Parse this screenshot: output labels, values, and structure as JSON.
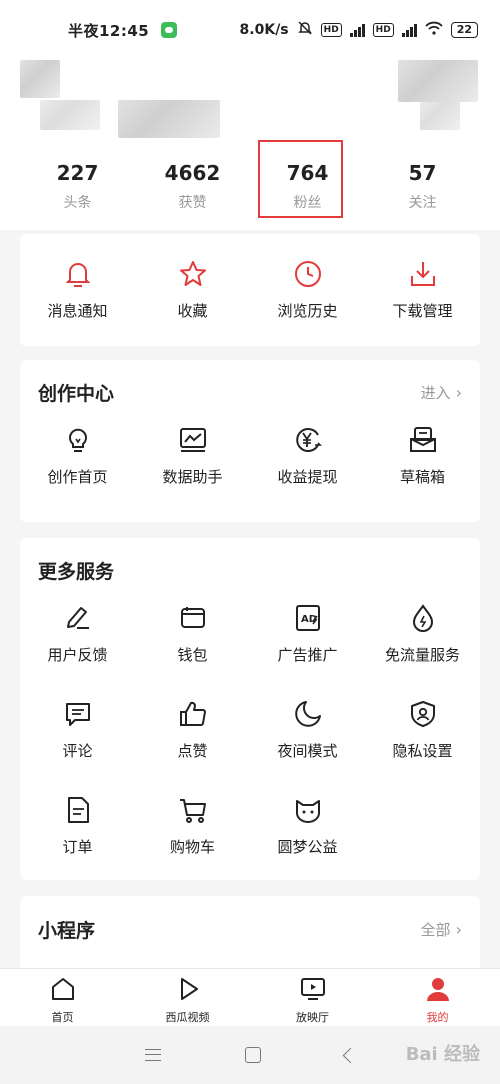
{
  "status_bar": {
    "time": "半夜12:45",
    "speed": "8.0K/s",
    "battery": "22"
  },
  "stats": [
    {
      "value": "227",
      "label": "头条"
    },
    {
      "value": "4662",
      "label": "获赞"
    },
    {
      "value": "764",
      "label": "粉丝"
    },
    {
      "value": "57",
      "label": "关注"
    }
  ],
  "quick_actions": [
    {
      "label": "消息通知",
      "icon": "bell-icon"
    },
    {
      "label": "收藏",
      "icon": "star-icon"
    },
    {
      "label": "浏览历史",
      "icon": "clock-icon"
    },
    {
      "label": "下载管理",
      "icon": "download-icon"
    }
  ],
  "creation_center": {
    "title": "创作中心",
    "more": "进入",
    "items": [
      {
        "label": "创作首页",
        "icon": "bulb-icon"
      },
      {
        "label": "数据助手",
        "icon": "chart-monitor-icon"
      },
      {
        "label": "收益提现",
        "icon": "yuan-icon"
      },
      {
        "label": "草稿箱",
        "icon": "drafts-icon"
      }
    ]
  },
  "more_services": {
    "title": "更多服务",
    "items": [
      {
        "label": "用户反馈",
        "icon": "pen-icon"
      },
      {
        "label": "钱包",
        "icon": "wallet-icon"
      },
      {
        "label": "广告推广",
        "icon": "ad-icon"
      },
      {
        "label": "免流量服务",
        "icon": "drop-icon"
      },
      {
        "label": "评论",
        "icon": "comment-icon"
      },
      {
        "label": "点赞",
        "icon": "thumb-icon"
      },
      {
        "label": "夜间模式",
        "icon": "moon-icon"
      },
      {
        "label": "隐私设置",
        "icon": "shield-icon"
      },
      {
        "label": "订单",
        "icon": "order-icon"
      },
      {
        "label": "购物车",
        "icon": "cart-icon"
      },
      {
        "label": "圆梦公益",
        "icon": "cat-icon"
      }
    ]
  },
  "mini_programs": {
    "title": "小程序",
    "more": "全部"
  },
  "tab_bar": [
    {
      "label": "首页",
      "icon": "home-icon"
    },
    {
      "label": "西瓜视频",
      "icon": "play-icon"
    },
    {
      "label": "放映厅",
      "icon": "screen-icon"
    },
    {
      "label": "我的",
      "icon": "user-icon"
    }
  ],
  "watermark": "Bai 经验",
  "colors": {
    "accent": "#e23b3b",
    "text": "#222222",
    "muted": "#999999",
    "background": "#f5f5f5"
  }
}
